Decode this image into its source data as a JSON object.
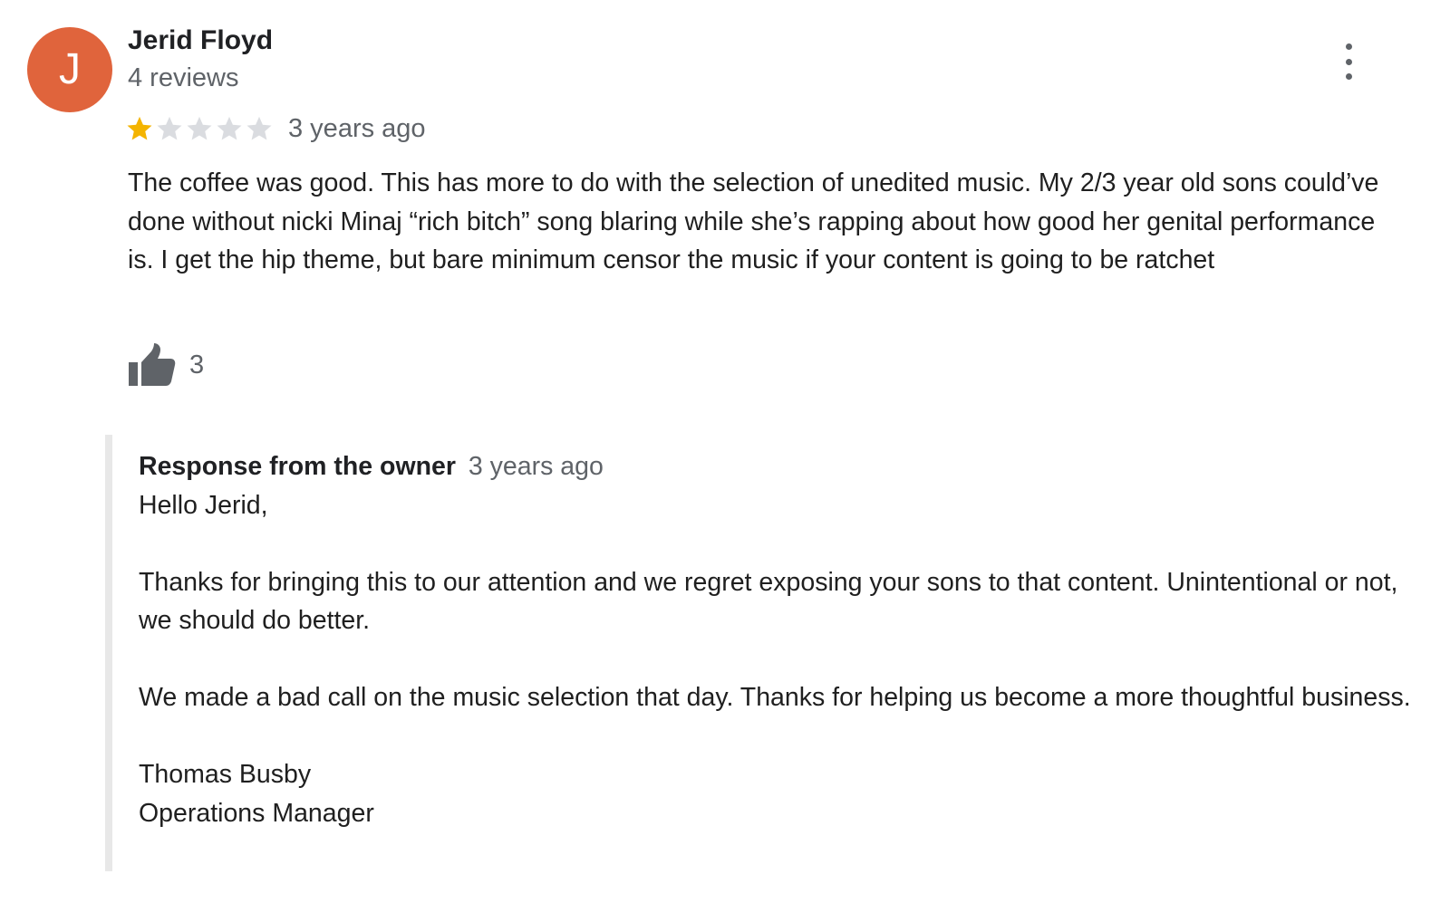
{
  "reviewer": {
    "initial": "J",
    "name": "Jerid Floyd",
    "review_count": "4 reviews",
    "avatar_color": "#e0643c"
  },
  "review": {
    "rating": 1,
    "max_rating": 5,
    "star_filled_color": "#f4b400",
    "star_empty_color": "#dadce0",
    "date": "3 years ago",
    "text": "The coffee was good. This has more to do with the selection of unedited music. My 2/3 year old sons could’ve done without nicki Minaj “rich bitch” song blaring while she’s rapping about how good her genital performance is. I get the hip theme, but bare minimum censor the music if your content is going to be ratchet",
    "likes": "3"
  },
  "icons": {
    "menu": "more-vert-icon",
    "like": "thumbs-up-icon",
    "star": "star-icon"
  },
  "owner_response": {
    "title": "Response from the owner",
    "date": "3 years ago",
    "greeting": "Hello Jerid,",
    "paragraph1": "Thanks for bringing this to our attention and we regret exposing your sons to that content. Unintentional or not, we should do better.",
    "paragraph2": "We made a bad call on the music selection that day. Thanks for helping us become a more thoughtful business.",
    "signature_name": "Thomas Busby",
    "signature_title": "Operations Manager"
  }
}
